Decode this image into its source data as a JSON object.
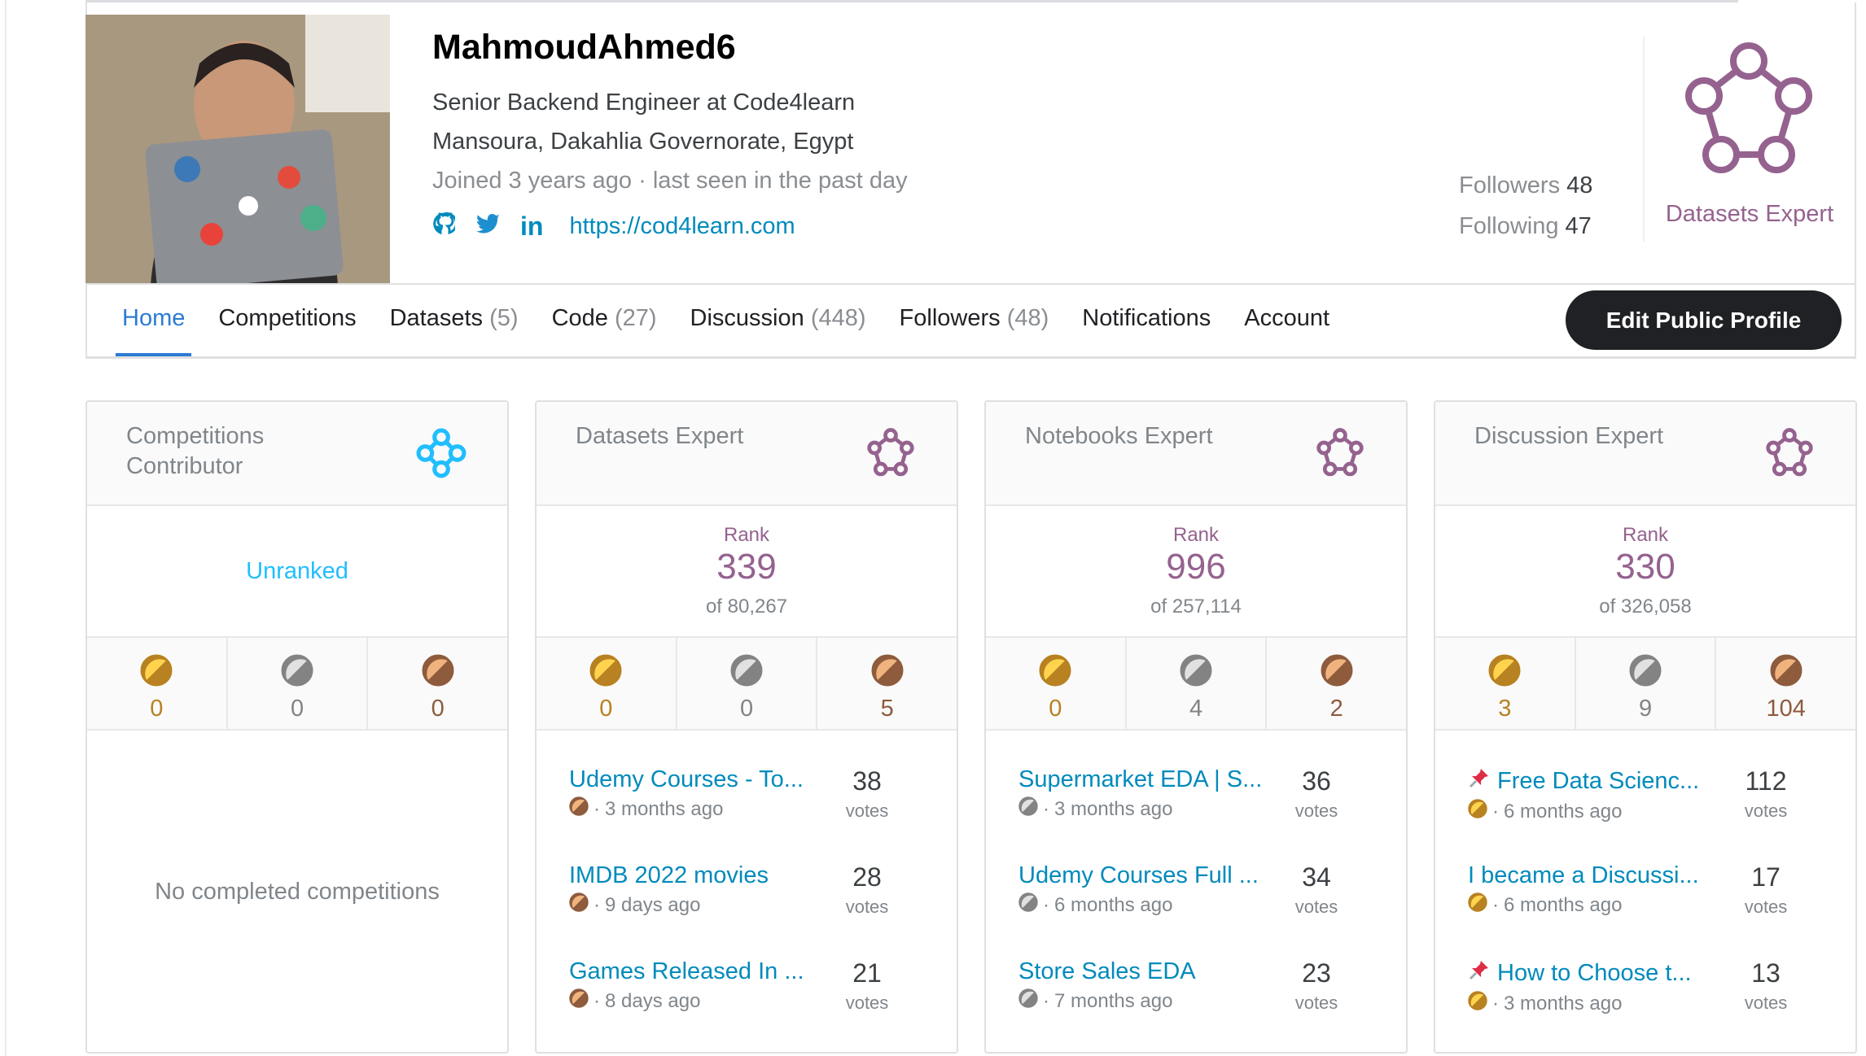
{
  "profile": {
    "name": "MahmoudAhmed6",
    "title": "Senior Backend Engineer at Code4learn",
    "location": "Mansoura, Dakahlia Governorate, Egypt",
    "joined": "Joined 3 years ago · last seen in the past day",
    "website": "https://cod4learn.com",
    "followers_label": "Followers",
    "followers": "48",
    "following_label": "Following",
    "following": "47",
    "highest_tier": "Datasets Expert"
  },
  "nav": {
    "tabs": [
      {
        "label": "Home",
        "count": ""
      },
      {
        "label": "Competitions",
        "count": ""
      },
      {
        "label": "Datasets",
        "count": "(5)"
      },
      {
        "label": "Code",
        "count": "(27)"
      },
      {
        "label": "Discussion",
        "count": "(448)"
      },
      {
        "label": "Followers",
        "count": "(48)"
      },
      {
        "label": "Notifications",
        "count": ""
      },
      {
        "label": "Account",
        "count": ""
      }
    ],
    "edit_label": "Edit Public Profile"
  },
  "colors": {
    "purple": "#95628f",
    "cyan": "#20beff",
    "link": "#008abc",
    "gold": "#b88121",
    "silver": "#838383",
    "bronze": "#8e5b3d"
  },
  "cards": [
    {
      "title": "Competitions Contributor",
      "unranked": "Unranked",
      "medals": {
        "gold": "0",
        "silver": "0",
        "bronze": "0"
      },
      "empty": "No completed competitions",
      "items": []
    },
    {
      "title": "Datasets Expert",
      "rank_label": "Rank",
      "rank": "339",
      "of": "of 80,267",
      "medals": {
        "gold": "0",
        "silver": "0",
        "bronze": "5"
      },
      "items": [
        {
          "title": "Udemy Courses - To...",
          "medal": "bronze",
          "time": "3 months ago",
          "votes": "38",
          "votes_label": "votes"
        },
        {
          "title": "IMDB 2022 movies",
          "medal": "bronze",
          "time": "9 days ago",
          "votes": "28",
          "votes_label": "votes"
        },
        {
          "title": "Games Released In ...",
          "medal": "bronze",
          "time": "8 days ago",
          "votes": "21",
          "votes_label": "votes"
        }
      ]
    },
    {
      "title": "Notebooks Expert",
      "rank_label": "Rank",
      "rank": "996",
      "of": "of 257,114",
      "medals": {
        "gold": "0",
        "silver": "4",
        "bronze": "2"
      },
      "items": [
        {
          "title": "Supermarket EDA | S...",
          "medal": "silver",
          "time": "3 months ago",
          "votes": "36",
          "votes_label": "votes"
        },
        {
          "title": "Udemy Courses Full ...",
          "medal": "silver",
          "time": "6 months ago",
          "votes": "34",
          "votes_label": "votes"
        },
        {
          "title": "Store Sales EDA",
          "medal": "silver",
          "time": "7 months ago",
          "votes": "23",
          "votes_label": "votes"
        }
      ]
    },
    {
      "title": "Discussion Expert",
      "rank_label": "Rank",
      "rank": "330",
      "of": "of 326,058",
      "medals": {
        "gold": "3",
        "silver": "9",
        "bronze": "104"
      },
      "items": [
        {
          "title": "Free Data Scienc...",
          "pinned": true,
          "medal": "gold",
          "time": "6 months ago",
          "votes": "112",
          "votes_label": "votes"
        },
        {
          "title": "I became a Discussi...",
          "pinned": false,
          "medal": "gold",
          "time": "6 months ago",
          "votes": "17",
          "votes_label": "votes"
        },
        {
          "title": "How to Choose t...",
          "pinned": true,
          "medal": "gold",
          "time": "3 months ago",
          "votes": "13",
          "votes_label": "votes"
        }
      ]
    }
  ]
}
